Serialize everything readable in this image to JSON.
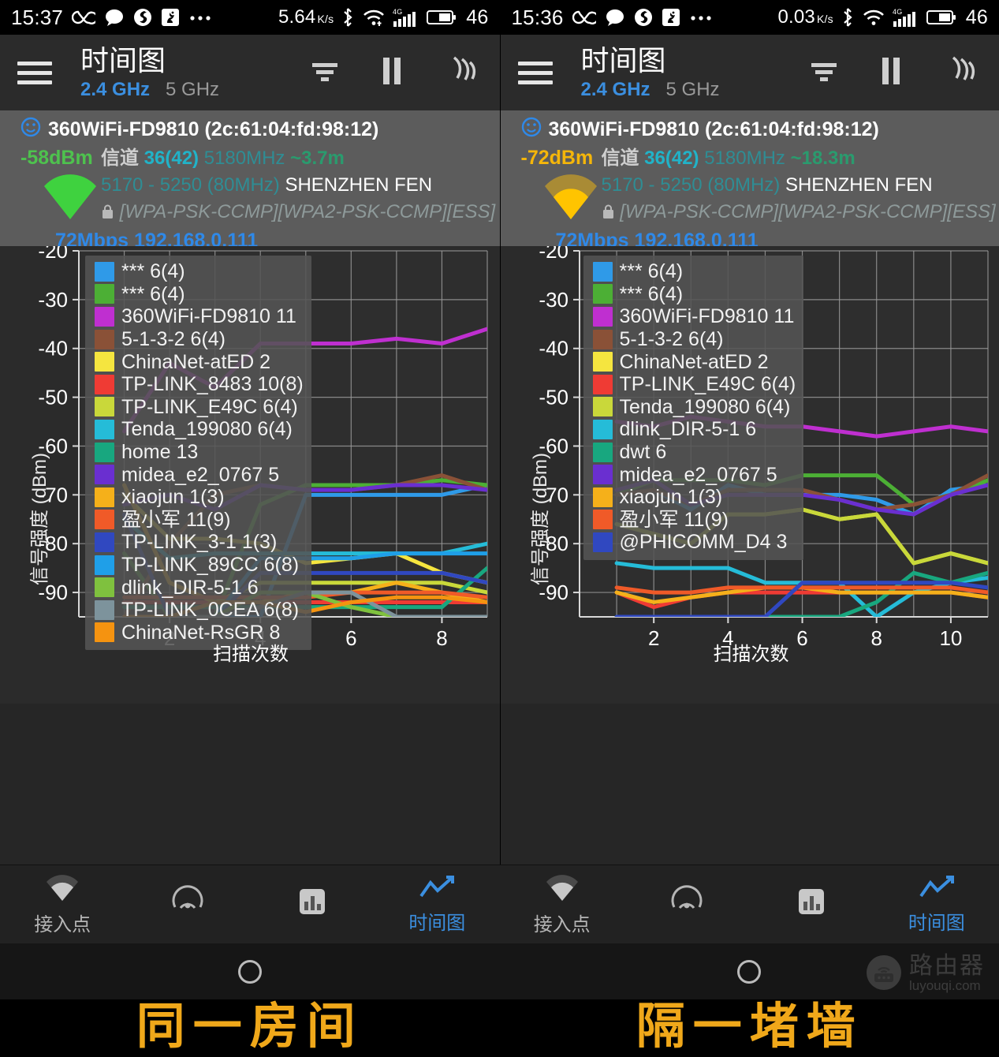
{
  "panes": [
    {
      "status_bar": {
        "time": "15:37",
        "icons": [
          "infinity-icon",
          "chat-bubble-icon",
          "app-icon",
          "squirrel-icon",
          "more-dots-icon"
        ],
        "net_speed": "5.64",
        "net_speed_unit": "K/s",
        "right_icons": [
          "bluetooth-icon",
          "wifi-icon",
          "signal-4g-icon",
          "battery-icon"
        ],
        "battery": "46",
        "mobile_net": "4G"
      },
      "appbar": {
        "title": "时间图",
        "bands": [
          {
            "label": "2.4 GHz",
            "active": true
          },
          {
            "label": "5 GHz",
            "active": false
          }
        ],
        "actions": [
          "filter-icon",
          "pause-icon",
          "scan-icon"
        ]
      },
      "ap": {
        "smiley": "☺",
        "ssid_mac": "360WiFi-FD9810 (2c:61:04:fd:98:12)",
        "dbm": "-58dBm",
        "dbm_color": "#4ec24e",
        "channel_label": "信道",
        "channel": "36(42)",
        "freq": "5180MHz",
        "distance": "~3.7m",
        "range": "5170 - 5250 (80MHz)",
        "vendor": "SHENZHEN FEN",
        "security": "[WPA-PSK-CCMP][WPA2-PSK-CCMP][ESS]",
        "rate": "72Mbps",
        "ip": "192.168.0.111"
      },
      "caption": "同一房间"
    },
    {
      "status_bar": {
        "time": "15:36",
        "icons": [
          "infinity-icon",
          "chat-bubble-icon",
          "app-icon",
          "squirrel-icon",
          "more-dots-icon"
        ],
        "net_speed": "0.03",
        "net_speed_unit": "K/s",
        "right_icons": [
          "bluetooth-icon",
          "wifi-icon",
          "signal-4g-icon",
          "battery-icon"
        ],
        "battery": "46",
        "mobile_net": "4G"
      },
      "appbar": {
        "title": "时间图",
        "bands": [
          {
            "label": "2.4 GHz",
            "active": true
          },
          {
            "label": "5 GHz",
            "active": false
          }
        ],
        "actions": [
          "filter-icon",
          "pause-icon",
          "scan-icon"
        ]
      },
      "ap": {
        "smiley": "☺",
        "ssid_mac": "360WiFi-FD9810 (2c:61:04:fd:98:12)",
        "dbm": "-72dBm",
        "dbm_color": "#f5b60a",
        "channel_label": "信道",
        "channel": "36(42)",
        "freq": "5180MHz",
        "distance": "~18.3m",
        "range": "5170 - 5250 (80MHz)",
        "vendor": "SHENZHEN FEN",
        "security": "[WPA-PSK-CCMP][WPA2-PSK-CCMP][ESS]",
        "rate": "72Mbps",
        "ip": "192.168.0.111"
      },
      "caption": "隔一堵墙"
    }
  ],
  "bottom_nav": [
    {
      "label": "接入点",
      "icon": "wifi-icon",
      "active": false
    },
    {
      "label": "",
      "icon": "radar-icon",
      "active": false
    },
    {
      "label": "",
      "icon": "bar-chart-icon",
      "active": false
    },
    {
      "label": "时间图",
      "icon": "line-chart-icon",
      "active": true
    }
  ],
  "watermark": {
    "cn": "路由器",
    "en": "luyouqi.com"
  },
  "chart_data": [
    {
      "type": "line",
      "title": "",
      "xlabel": "扫描次数",
      "ylabel": "信号强度 (dBm)",
      "ylim": [
        -95,
        -20
      ],
      "yticks": [
        -20,
        -30,
        -40,
        -50,
        -60,
        -70,
        -80,
        -90
      ],
      "xlim": [
        0,
        9
      ],
      "xticks": [
        2,
        4,
        6,
        8
      ],
      "grid": true,
      "legend_position": "upper-left",
      "x": [
        1,
        2,
        3,
        4,
        5,
        6,
        7,
        8,
        9
      ],
      "series": [
        {
          "name": "*** 6(4)",
          "color": "#2f9ae8",
          "values": [
            -95,
            -95,
            -95,
            -95,
            -70,
            -70,
            -70,
            -70,
            -68
          ]
        },
        {
          "name": "*** 6(4)",
          "color": "#4caf35",
          "values": [
            -82,
            -95,
            -95,
            -72,
            -68,
            -68,
            -68,
            -67,
            -68
          ]
        },
        {
          "name": "360WiFi-FD9810 11",
          "color": "#bf2fd0",
          "values": [
            -57,
            -43,
            -48,
            -39,
            -39,
            -39,
            -38,
            -39,
            -36
          ]
        },
        {
          "name": "5-1-3-2 6(4)",
          "color": "#8a5137",
          "values": [
            -95,
            -80,
            -70,
            -68,
            -69,
            -69,
            -68,
            -66,
            -69
          ]
        },
        {
          "name": "ChinaNet-atED 2",
          "color": "#f5e53f",
          "values": [
            -70,
            -79,
            -79,
            -80,
            -84,
            -83,
            -82,
            -86,
            -88
          ]
        },
        {
          "name": "TP-LINK_8483 10(8)",
          "color": "#ef3b34",
          "values": [
            -92,
            -92,
            -92,
            -92,
            -92,
            -92,
            -92,
            -92,
            -92
          ]
        },
        {
          "name": "TP-LINK_E49C 6(4)",
          "color": "#c9d83a",
          "values": [
            -68,
            -88,
            -92,
            -88,
            -88,
            -88,
            -88,
            -88,
            -90
          ]
        },
        {
          "name": "Tenda_199080 6(4)",
          "color": "#25bcd8",
          "values": [
            -75,
            -83,
            -82,
            -82,
            -82,
            -82,
            -82,
            -82,
            -80
          ]
        },
        {
          "name": "home 13",
          "color": "#18a77f",
          "values": [
            -93,
            -93,
            -93,
            -93,
            -93,
            -93,
            -93,
            -93,
            -85
          ]
        },
        {
          "name": "midea_e2_0767 5",
          "color": "#6a2fd0",
          "values": [
            -72,
            -70,
            -73,
            -68,
            -69,
            -69,
            -68,
            -68,
            -69
          ]
        },
        {
          "name": "xiaojun 1(3)",
          "color": "#f5b01a",
          "values": [
            -68,
            -88,
            -92,
            -92,
            -90,
            -90,
            -88,
            -90,
            -92
          ]
        },
        {
          "name": "盈小军 11(9)",
          "color": "#f05a28",
          "values": [
            -91,
            -91,
            -91,
            -91,
            -91,
            -90,
            -90,
            -90,
            -91
          ]
        },
        {
          "name": "TP-LINK_3-1 1(3)",
          "color": "#3048c0",
          "values": [
            -74,
            -95,
            -95,
            -86,
            -86,
            -86,
            -86,
            -86,
            -88
          ]
        },
        {
          "name": "TP-LINK_89CC 6(8)",
          "color": "#1f9fe8",
          "values": [
            -95,
            -95,
            -95,
            -83,
            -83,
            -83,
            -82,
            -82,
            -82
          ]
        },
        {
          "name": "dlink_DIR-5-1 6",
          "color": "#7fc13e",
          "values": [
            -95,
            -95,
            -95,
            -90,
            -90,
            -93,
            -95,
            -95,
            -95
          ]
        },
        {
          "name": "TP-LINK_0CEA 6(8)",
          "color": "#7d939c",
          "values": [
            -95,
            -95,
            -95,
            -93,
            -90,
            -90,
            -95,
            -95,
            -95
          ]
        },
        {
          "name": "ChinaNet-RsGR 8",
          "color": "#f59310",
          "values": [
            -95,
            -95,
            -92,
            -92,
            -94,
            -92,
            -91,
            -91,
            -92
          ]
        }
      ]
    },
    {
      "type": "line",
      "title": "",
      "xlabel": "扫描次数",
      "ylabel": "信号强度 (dBm)",
      "ylim": [
        -95,
        -20
      ],
      "yticks": [
        -20,
        -30,
        -40,
        -50,
        -60,
        -70,
        -80,
        -90
      ],
      "xlim": [
        0,
        11
      ],
      "xticks": [
        2,
        4,
        6,
        8,
        10
      ],
      "grid": true,
      "legend_position": "upper-left",
      "x": [
        1,
        2,
        3,
        4,
        5,
        6,
        7,
        8,
        9,
        10,
        11
      ],
      "series": [
        {
          "name": "*** 6(4)",
          "color": "#2f9ae8",
          "values": [
            -70,
            -69,
            -73,
            -68,
            -70,
            -70,
            -70,
            -71,
            -74,
            -69,
            -68
          ]
        },
        {
          "name": "*** 6(4)",
          "color": "#4caf35",
          "values": [
            -70,
            -67,
            -67,
            -67,
            -68,
            -66,
            -66,
            -66,
            -72,
            -70,
            -67
          ]
        },
        {
          "name": "360WiFi-FD9810 11",
          "color": "#bf2fd0",
          "values": [
            -55,
            -56,
            -54,
            -55,
            -56,
            -56,
            -57,
            -58,
            -57,
            -56,
            -57
          ]
        },
        {
          "name": "5-1-3-2 6(4)",
          "color": "#8a5137",
          "values": [
            -70,
            -69,
            -72,
            -69,
            -69,
            -69,
            -71,
            -73,
            -72,
            -70,
            -66
          ]
        },
        {
          "name": "ChinaNet-atED 2",
          "color": "#f5e53f",
          "values": [
            -76,
            -78,
            -80,
            -74,
            -74,
            -73,
            -75,
            -74,
            -84,
            -82,
            -84
          ]
        },
        {
          "name": "TP-LINK_E49C 6(4)",
          "color": "#ef3b34",
          "values": [
            -90,
            -93,
            -91,
            -90,
            -90,
            -90,
            -90,
            -90,
            -90,
            -90,
            -91
          ]
        },
        {
          "name": "Tenda_199080 6(4)",
          "color": "#c9d83a",
          "values": [
            -76,
            -78,
            -80,
            -74,
            -74,
            -73,
            -75,
            -74,
            -84,
            -82,
            -84
          ]
        },
        {
          "name": "dlink_DIR-5-1 6",
          "color": "#25bcd8",
          "values": [
            -84,
            -85,
            -85,
            -85,
            -88,
            -88,
            -88,
            -95,
            -90,
            -88,
            -87
          ]
        },
        {
          "name": "dwt 6",
          "color": "#18a77f",
          "values": [
            -95,
            -95,
            -95,
            -95,
            -95,
            -95,
            -95,
            -92,
            -86,
            -88,
            -86
          ]
        },
        {
          "name": "midea_e2_0767 5",
          "color": "#6a2fd0",
          "values": [
            -69,
            -67,
            -72,
            -70,
            -70,
            -70,
            -71,
            -73,
            -74,
            -70,
            -68
          ]
        },
        {
          "name": "xiaojun 1(3)",
          "color": "#f5b01a",
          "values": [
            -90,
            -92,
            -91,
            -90,
            -89,
            -89,
            -90,
            -90,
            -90,
            -90,
            -91
          ]
        },
        {
          "name": "盈小军 11(9)",
          "color": "#f05a28",
          "values": [
            -89,
            -90,
            -90,
            -89,
            -89,
            -89,
            -89,
            -89,
            -89,
            -89,
            -90
          ]
        },
        {
          "name": "@PHICOMM_D4 3",
          "color": "#3048c0",
          "values": [
            -95,
            -95,
            -95,
            -95,
            -95,
            -88,
            -88,
            -88,
            -88,
            -88,
            -89
          ]
        }
      ]
    }
  ]
}
